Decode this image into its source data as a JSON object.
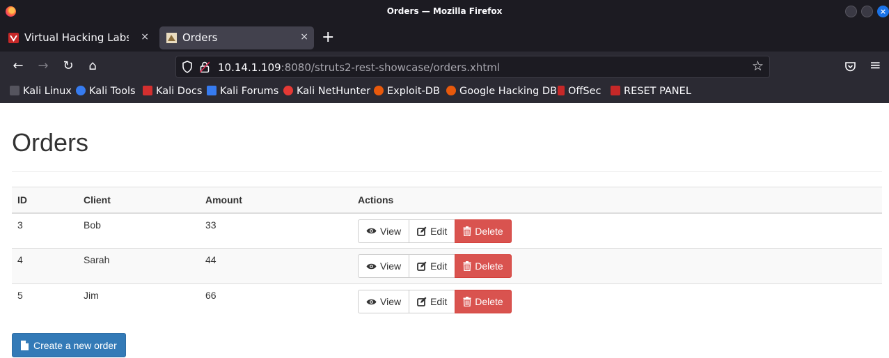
{
  "window": {
    "title": "Orders — Mozilla Firefox",
    "close_glyph": "×"
  },
  "tabs": [
    {
      "label": "Virtual Hacking Labs - Res",
      "close": "×"
    },
    {
      "label": "Orders",
      "close": "×"
    }
  ],
  "new_tab": "+",
  "nav": {
    "back": "←",
    "forward": "→",
    "reload": "↻",
    "home": "⌂",
    "menu": "≡",
    "star": "☆"
  },
  "address": {
    "host": "10.14.1.109",
    "rest": ":8080/struts2-rest-showcase/orders.xhtml"
  },
  "bookmarks": [
    {
      "label": "Kali Linux",
      "icon": "kali-dragon-icon",
      "color": "#1c1b22"
    },
    {
      "label": "Kali Tools",
      "icon": "kali-tools-icon",
      "color": "#367bf0"
    },
    {
      "label": "Kali Docs",
      "icon": "kali-docs-icon",
      "color": "#d32f2f"
    },
    {
      "label": "Kali Forums",
      "icon": "kali-forums-icon",
      "color": "#367bf0"
    },
    {
      "label": "Kali NetHunter",
      "icon": "nethunter-icon",
      "color": "#e53935"
    },
    {
      "label": "Exploit-DB",
      "icon": "exploit-db-icon",
      "color": "#e8590c"
    },
    {
      "label": "Google Hacking DB",
      "icon": "ghdb-icon",
      "color": "#e8590c"
    },
    {
      "label": "OffSec",
      "icon": "offsec-icon",
      "color": "#c62828"
    },
    {
      "label": "RESET PANEL",
      "icon": "reset-panel-icon",
      "color": "#c62828"
    }
  ],
  "page": {
    "heading": "Orders",
    "table": {
      "headers": [
        "ID",
        "Client",
        "Amount",
        "Actions"
      ],
      "rows": [
        {
          "id": "3",
          "client": "Bob",
          "amount": "33"
        },
        {
          "id": "4",
          "client": "Sarah",
          "amount": "44"
        },
        {
          "id": "5",
          "client": "Jim",
          "amount": "66"
        }
      ],
      "actions": {
        "view": "View",
        "edit": "Edit",
        "delete": "Delete"
      }
    },
    "create_button": "Create a new order"
  },
  "colors": {
    "primary": "#337ab7",
    "danger": "#d9534f",
    "chrome_dark": "#1c1b22",
    "chrome_mid": "#2b2a33"
  }
}
